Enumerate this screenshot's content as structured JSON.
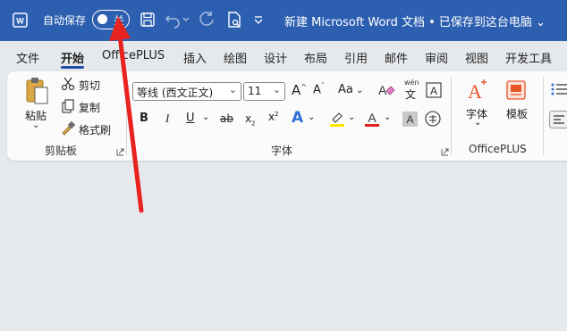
{
  "titlebar": {
    "autosave_label": "自动保存",
    "autosave_state": "关",
    "document_title": "新建 Microsoft Word 文档 • 已保存到这台电脑 ⌄"
  },
  "tabs": [
    "文件",
    "开始",
    "OfficePLUS",
    "插入",
    "绘图",
    "设计",
    "布局",
    "引用",
    "邮件",
    "审阅",
    "视图",
    "开发工具"
  ],
  "active_tab": "开始",
  "ribbon": {
    "clipboard": {
      "paste": "粘贴",
      "cut": "剪切",
      "copy": "复制",
      "format_painter": "格式刷",
      "group_label": "剪贴板"
    },
    "font": {
      "font_name": "等线 (西文正文)",
      "font_size": "11",
      "bold": "B",
      "italic": "I",
      "underline": "U",
      "strikethrough": "ab",
      "subscript": "x",
      "superscript": "x",
      "phonetic_top": "wén",
      "phonetic_bottom": "文",
      "group_label": "字体"
    },
    "officeplus": {
      "font_btn": "字体",
      "template_btn": "模板",
      "group_label": "OfficePLUS"
    }
  },
  "colors": {
    "titlebar": "#2d5fb0",
    "highlight": "#ffe800",
    "font_color": "#e02020",
    "arrow_annotation": "#e8221e",
    "accent": "#1f4ea8"
  }
}
